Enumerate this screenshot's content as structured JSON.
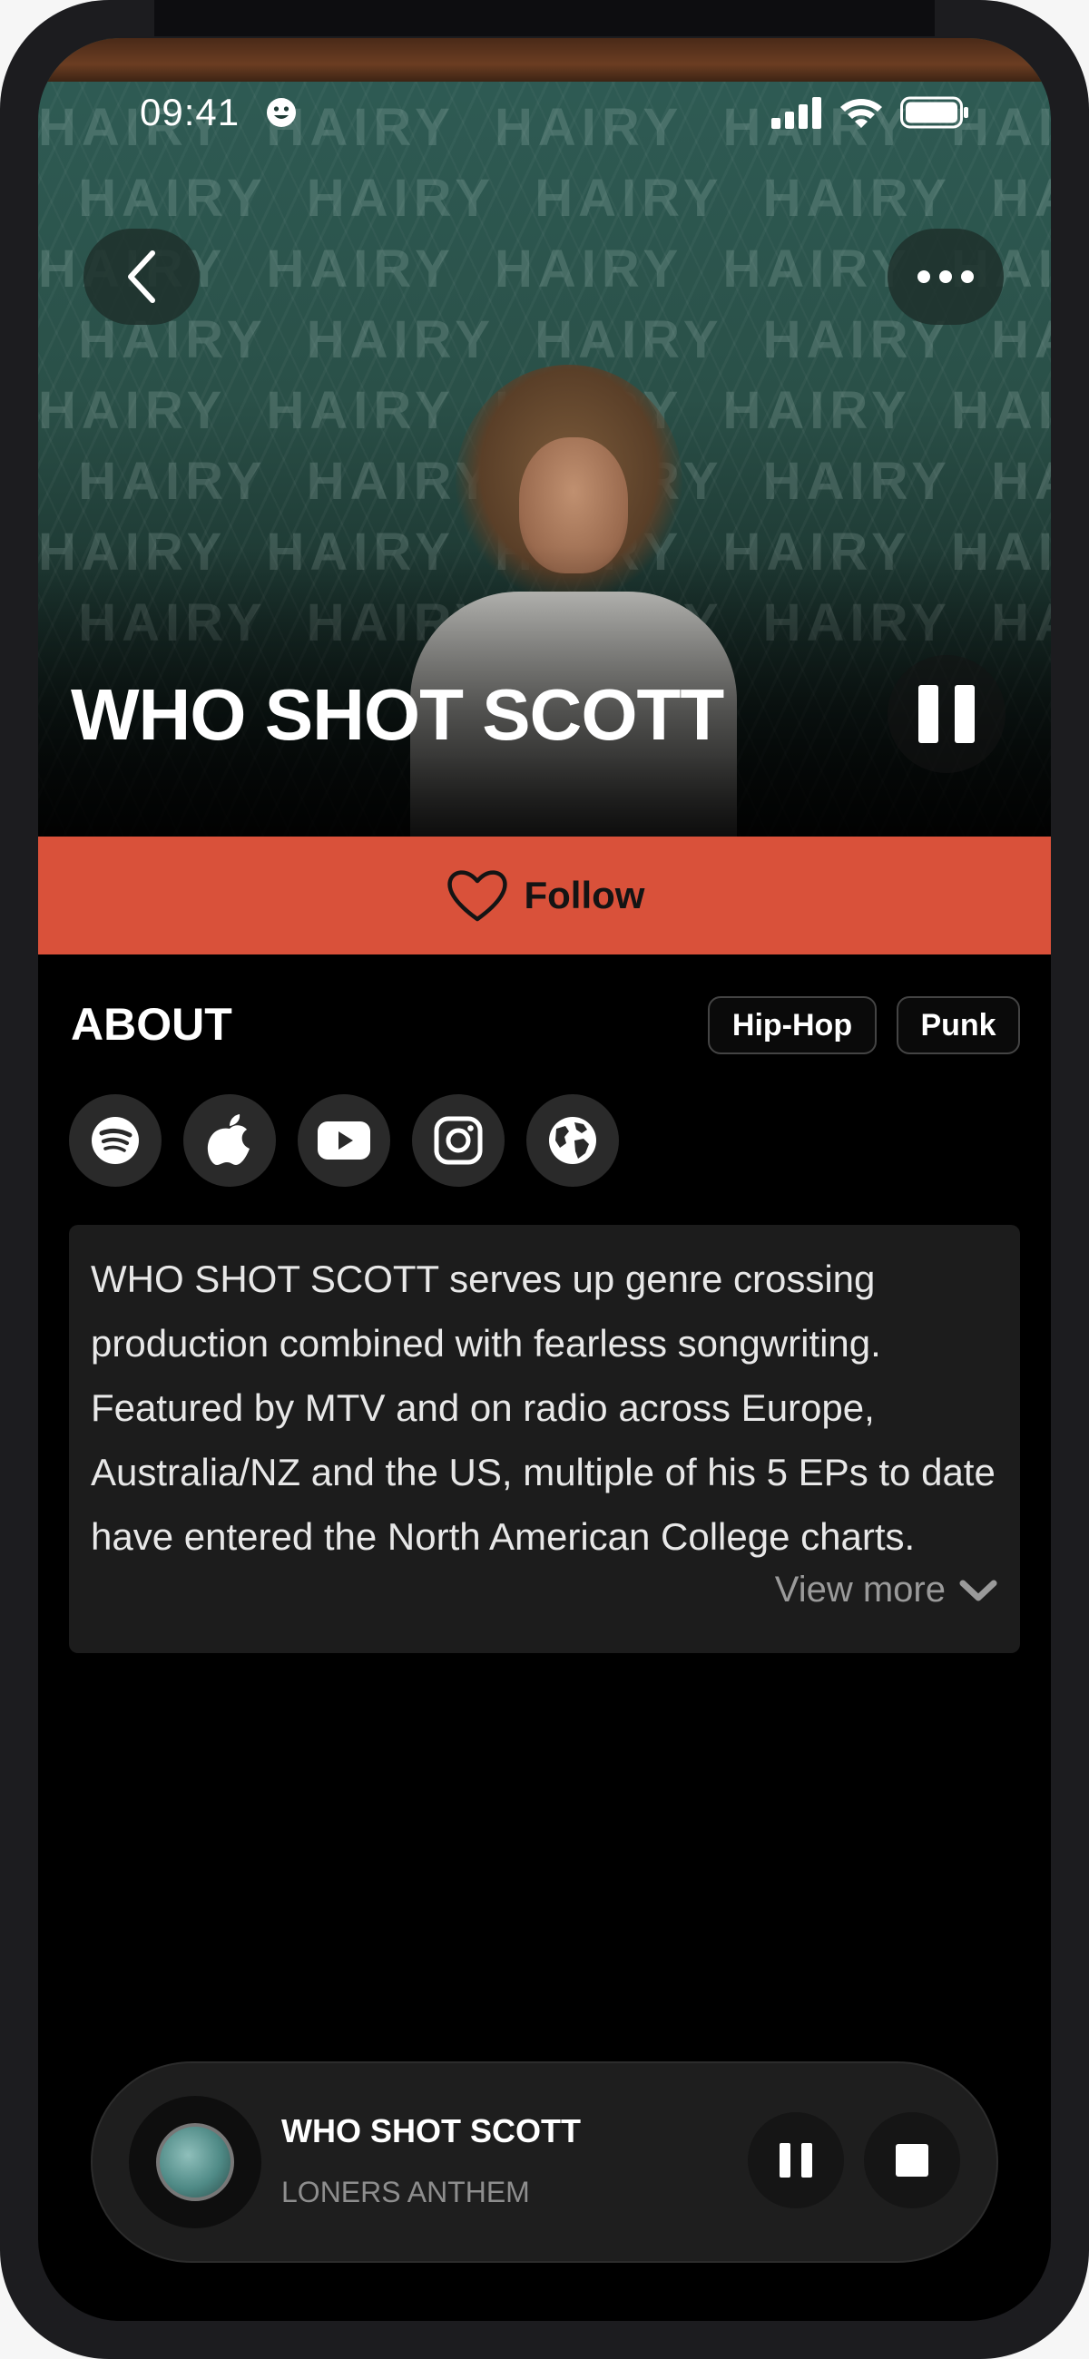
{
  "status_bar": {
    "time": "09:41"
  },
  "hero": {
    "artist_name": "WHO SHOT SCOTT",
    "background_words": "HAIRY"
  },
  "follow": {
    "label": "Follow"
  },
  "about": {
    "heading": "ABOUT",
    "tags": [
      "Hip-Hop",
      "Punk"
    ],
    "social_icons": [
      "spotify-icon",
      "apple-icon",
      "youtube-icon",
      "instagram-icon",
      "globe-icon"
    ],
    "bio": "WHO SHOT SCOTT serves up genre crossing production combined with fearless songwriting. Featured by MTV and on radio across Europe, Australia/NZ and the US, multiple of his 5 EPs to date have entered the North American College charts.",
    "view_more": "View more"
  },
  "player": {
    "artist": "WHO SHOT SCOTT",
    "track": "LONERS ANTHEM"
  },
  "colors": {
    "accent": "#d9513a",
    "background": "#000000",
    "card": "#1c1c1c"
  }
}
